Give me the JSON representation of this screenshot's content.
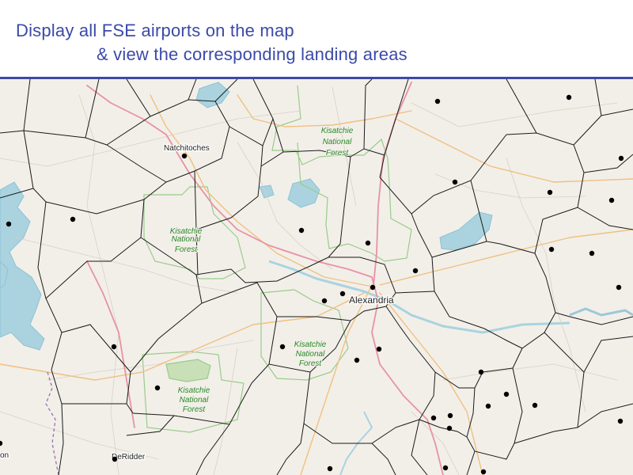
{
  "header": {
    "line1": "Display all FSE airports on the map",
    "line2": "& view the corresponding landing areas"
  },
  "map": {
    "colors": {
      "land": "#f2efe9",
      "water": "#aad3df",
      "forest_border": "#9acb8a",
      "forest_label": "#2a8a2a",
      "primary_road": "#e892a2",
      "secondary_road": "#f0c080",
      "minor_road": "#c8c0b4",
      "voronoi": "#1a1a1a",
      "airport": "#000000",
      "accent": "#3b4aa8"
    },
    "places": {
      "natchitoches": "Natchitoches",
      "alexandria": "Alexandria",
      "deridder": "DeRidder",
      "edge_label": "on"
    },
    "forests": {
      "north_1": "Kisatchie",
      "north_2": "National",
      "north_3": "Forest",
      "west_1": "Kisatchie",
      "west_2": "National",
      "west_3": "Forest",
      "central_1": "Kisatchie",
      "central_2": "National",
      "central_3": "Forest",
      "south_1": "Kisatchie",
      "south_2": "National",
      "south_3": "Forest"
    }
  }
}
